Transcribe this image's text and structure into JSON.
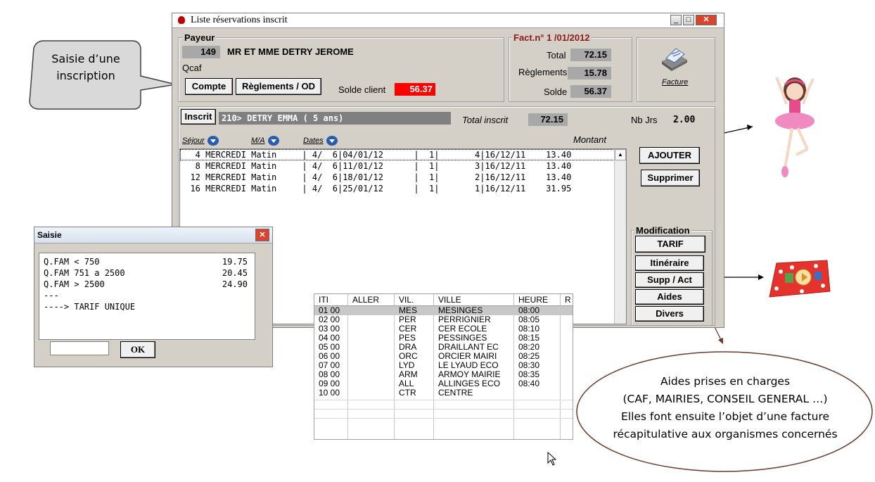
{
  "callout_left": {
    "line1": "Saisie d’une",
    "line2": "inscription"
  },
  "window": {
    "title": "Liste réservations inscrit",
    "payeur": {
      "group_label": "Payeur",
      "code": "149",
      "name": "MR ET MME DETRY JEROME",
      "sub": "Qcaf",
      "compte_label": "Compte",
      "reglements_label": "Règlements / OD",
      "solde_client_label": "Solde client",
      "solde_client_value": "56.37"
    },
    "facture": {
      "group_label": "Fact.n° 1 /01/2012",
      "total_label": "Total",
      "total_value": "72.15",
      "reglements_label": "Règlements",
      "reglements_value": "15.78",
      "solde_label": "Solde",
      "solde_value": "56.37",
      "icon_label": "Facture"
    },
    "inscrit": {
      "button_label": "Inscrit",
      "value": "210> DETRY EMMA ( 5 ans)",
      "total_inscrit_label": "Total inscrit",
      "total_inscrit_value": "72.15",
      "nb_jrs_label": "Nb Jrs",
      "nb_jrs_value": "2.00"
    },
    "list_headers": {
      "sejour": "Séjour",
      "ma": "M/A",
      "dates": "Dates",
      "montant": "Montant"
    },
    "rows": [
      "   4 MERCREDI Matin     | 4/  6|04/01/12      |  1|       4|16/12/11    13.40",
      "   8 MERCREDI Matin     | 4/  6|11/01/12      |  1|       3|16/12/11    13.40",
      "  12 MERCREDI Matin     | 4/  6|18/01/12      |  1|       2|16/12/11    13.40",
      "  16 MERCREDI Matin     | 4/  6|25/01/12      |  1|       1|16/12/11    31.95"
    ],
    "ajouter_label": "AJOUTER",
    "supprimer_label": "Supprimer",
    "modification": {
      "group_label": "Modification",
      "tarif": "TARIF",
      "itineraire": "Itinéraire",
      "supp_act": "Supp / Act",
      "aides": "Aides",
      "divers": "Divers"
    }
  },
  "saisie": {
    "title": "Saisie",
    "lines": [
      {
        "label": "Q.FAM < 750",
        "value": "19.75"
      },
      {
        "label": "Q.FAM 751 a 2500",
        "value": "20.45"
      },
      {
        "label": "Q.FAM > 2500",
        "value": "24.90"
      },
      {
        "label": "---",
        "value": ""
      },
      {
        "label": "----> TARIF UNIQUE",
        "value": ""
      }
    ],
    "input_value": "",
    "ok_label": "OK"
  },
  "itineraire_table": {
    "headers": [
      "ITI",
      "ALLER",
      "VIL.",
      "VILLE",
      "HEURE",
      "R"
    ],
    "rows": [
      [
        "01 00",
        "",
        "MES",
        "MESINGES",
        "08:00"
      ],
      [
        "02 00",
        "",
        "PER",
        "PERRIGNIER",
        "08:05"
      ],
      [
        "03 00",
        "",
        "CER",
        "CER ECOLE",
        "08:10"
      ],
      [
        "04 00",
        "",
        "PES",
        "PESSINGES",
        "08:15"
      ],
      [
        "05 00",
        "",
        "DRA",
        "DRAILLANT EC",
        "08:20"
      ],
      [
        "06 00",
        "",
        "ORC",
        "ORCIER MAIRI",
        "08:25"
      ],
      [
        "07 00",
        "",
        "LYD",
        "LE LYAUD ECO",
        "08:30"
      ],
      [
        "08 00",
        "",
        "ARM",
        "ARMOY MAIRIE",
        "08:35"
      ],
      [
        "09 00",
        "",
        "ALL",
        "ALLINGES ECO",
        "08:40"
      ],
      [
        "10 00",
        "",
        "CTR",
        "CENTRE",
        ""
      ]
    ]
  },
  "callout_aides": {
    "line1": "Aides prises en charges",
    "line2": "(CAF, MAIRIES, CONSEIL GENERAL …)",
    "line3": "Elles font ensuite l’objet d’une facture",
    "line4": "récapitulative aux organismes concernés"
  },
  "colors": {
    "solde_red": "#ff0000",
    "selection": "#c8c8c8",
    "callout_fill": "#d9d9d9"
  }
}
